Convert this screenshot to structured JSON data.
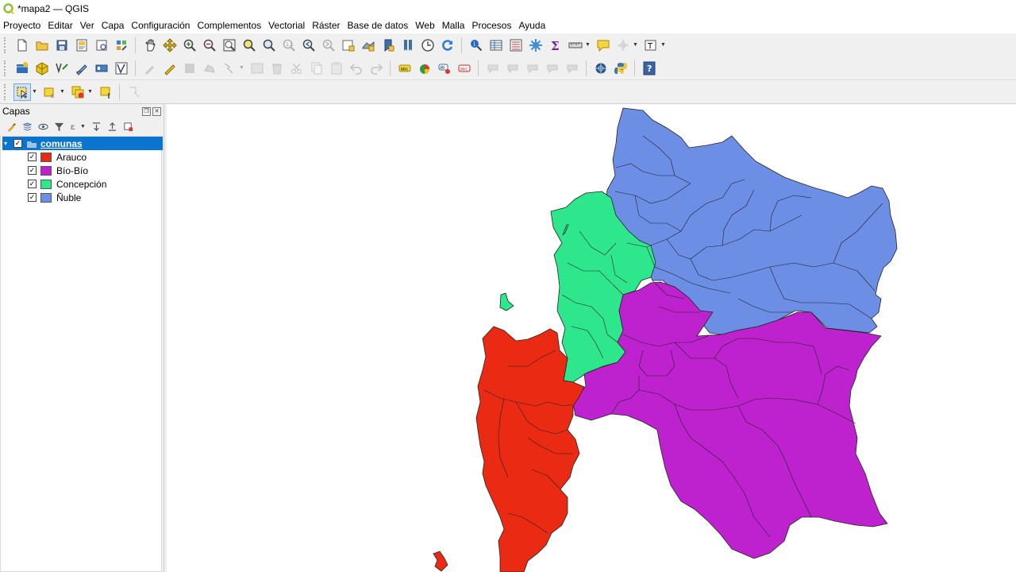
{
  "window": {
    "title": "*mapa2 — QGIS"
  },
  "menu": [
    "Proyecto",
    "Editar",
    "Ver",
    "Capa",
    "Configuración",
    "Complementos",
    "Vectorial",
    "Ráster",
    "Base de datos",
    "Web",
    "Malla",
    "Procesos",
    "Ayuda"
  ],
  "panel": {
    "title": "Capas"
  },
  "layers": {
    "group": {
      "name": "comunas",
      "checked": true
    },
    "items": [
      {
        "name": "Arauco",
        "color": "#ea2a12",
        "checked": true
      },
      {
        "name": "Bío-Bío",
        "color": "#be22cf",
        "checked": true
      },
      {
        "name": "Concepción",
        "color": "#2ee68b",
        "checked": true
      },
      {
        "name": "Ñuble",
        "color": "#6d8ee5",
        "checked": true
      }
    ]
  },
  "icons": {
    "toolbar1": [
      "new-project-icon",
      "open-project-icon",
      "save-project-icon",
      "print-layout-icon",
      "layout-manager-icon",
      "style-manager-icon",
      "pan-icon",
      "pan-to-selection-icon",
      "zoom-in-icon",
      "zoom-out-icon",
      "zoom-full-icon",
      "zoom-to-selection-icon",
      "zoom-to-layer-icon",
      "zoom-native-icon",
      "zoom-last-icon",
      "zoom-next-icon",
      "new-map-view-icon",
      "new-3d-view-icon",
      "bookmark-icon",
      "show-bookmarks-icon",
      "temporal-controller-icon",
      "refresh-icon",
      "identify-icon",
      "attribute-table-icon",
      "field-calculator-icon",
      "processing-toolbox-icon",
      "statistics-icon",
      "measure-icon",
      "map-tips-icon",
      "annotation-icon",
      "text-annotation-icon"
    ],
    "toolbar2": [
      "datasource-manager-icon",
      "new-geopackage-icon",
      "new-shapefile-icon",
      "digitize-icon",
      "virtual-layer-icon",
      "vertex-tool-icon",
      "toggle-edit-icon",
      "save-edits-icon",
      "add-feature-icon",
      "move-feature-icon",
      "delete-icon",
      "cut-icon",
      "copy-icon",
      "paste-icon",
      "undo-icon",
      "redo-icon",
      "label-icon",
      "layer-diagram-icon",
      "highlight-label-icon",
      "label-pin-icon",
      "plugin-icon",
      "python-console-icon",
      "help-icon"
    ],
    "toolbar3": [
      "select-features-icon",
      "select-by-expression-icon",
      "deselect-icon",
      "select-by-location-icon",
      "show-tips-icon"
    ]
  }
}
